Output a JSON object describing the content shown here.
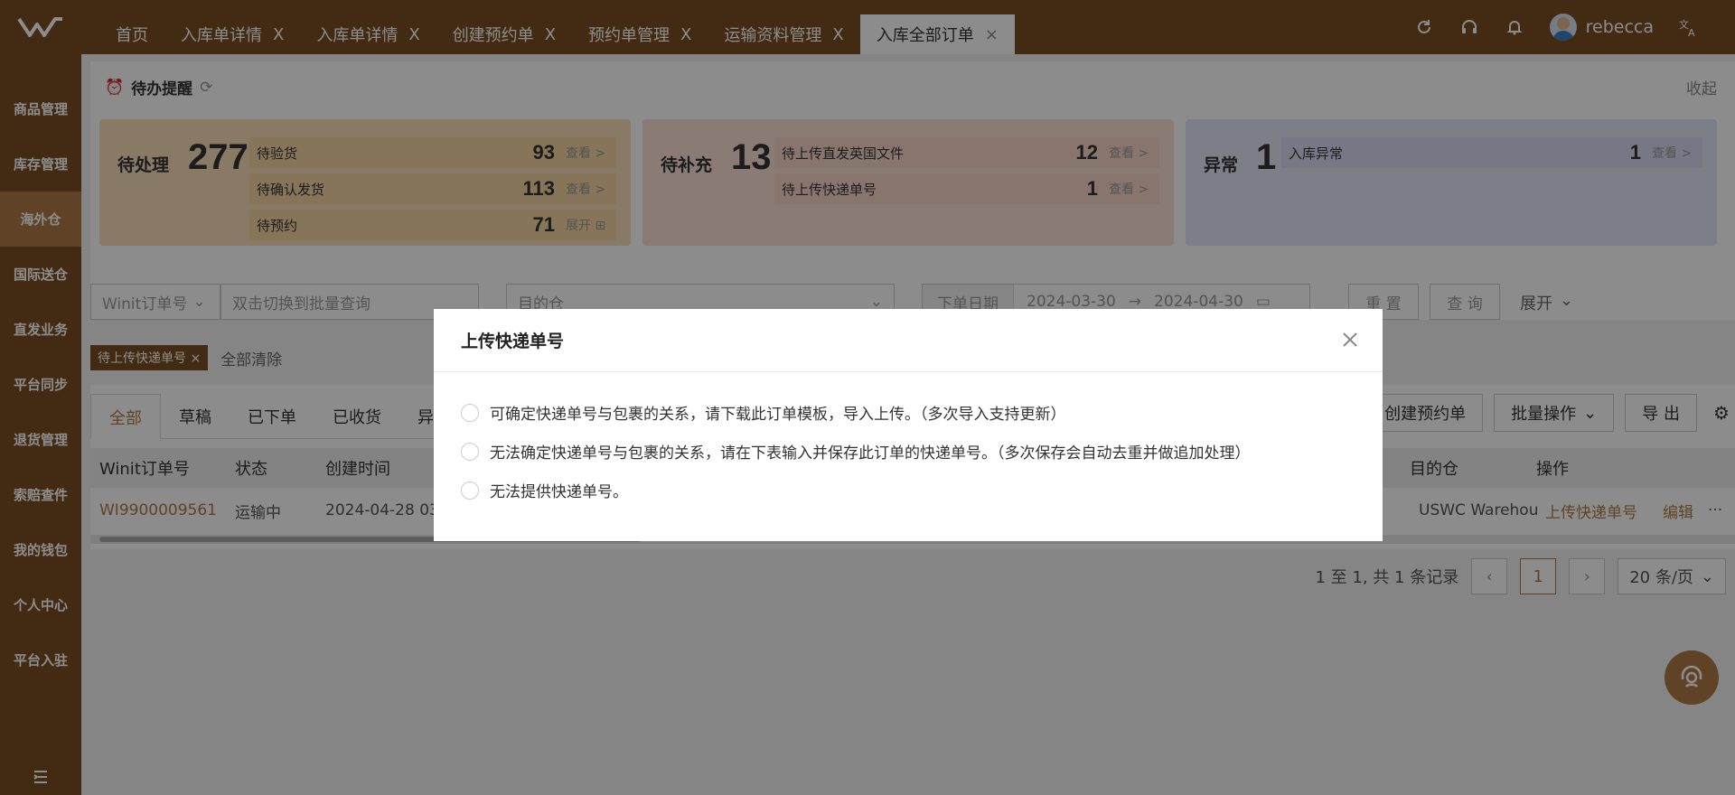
{
  "topbar": {
    "tabs": [
      {
        "label": "首页",
        "closable": false
      },
      {
        "label": "入库单详情",
        "closable": true
      },
      {
        "label": "入库单详情",
        "closable": true
      },
      {
        "label": "创建预约单",
        "closable": true
      },
      {
        "label": "预约单管理",
        "closable": true
      },
      {
        "label": "运输资料管理",
        "closable": true
      },
      {
        "label": "入库全部订单",
        "closable": true,
        "active": true
      }
    ],
    "close_glyph": "X",
    "username": "rebecca",
    "icons": [
      "refresh-icon",
      "headset-icon",
      "bell-icon",
      "translate-icon"
    ]
  },
  "sidebar": {
    "items": [
      {
        "label": "商品管理"
      },
      {
        "label": "库存管理"
      },
      {
        "label": "海外仓",
        "active": true
      },
      {
        "label": "国际送仓"
      },
      {
        "label": "直发业务"
      },
      {
        "label": "平台同步"
      },
      {
        "label": "退货管理"
      },
      {
        "label": "索赔查件"
      },
      {
        "label": "我的钱包"
      },
      {
        "label": "个人中心"
      },
      {
        "label": "平台入驻"
      }
    ]
  },
  "todo": {
    "title": "待办提醒",
    "collapse": "收起",
    "cards": [
      {
        "title": "待处理",
        "count": "277",
        "rows": [
          {
            "label": "待验货",
            "value": "93",
            "link": "查看 >"
          },
          {
            "label": "待确认发货",
            "value": "113",
            "link": "查看 >"
          },
          {
            "label": "待预约",
            "value": "71",
            "link": "展开 ⊞"
          }
        ]
      },
      {
        "title": "待补充",
        "count": "13",
        "rows": [
          {
            "label": "待上传直发英国文件",
            "value": "12",
            "link": "查看 >"
          },
          {
            "label": "待上传快递单号",
            "value": "1",
            "link": "查看 >"
          }
        ]
      },
      {
        "title": "异常",
        "count": "1",
        "rows": [
          {
            "label": "入库异常",
            "value": "1",
            "link": "查看 >"
          }
        ]
      }
    ]
  },
  "filters": {
    "order_type": "Winit订单号",
    "search_placeholder": "双击切换到批量查询",
    "warehouse_placeholder": "目的仓",
    "date_label": "下单日期",
    "date_start": "2024-03-30",
    "date_arrow": "→",
    "date_end": "2024-04-30",
    "reset": "重 置",
    "query": "查 询",
    "expand": "展开"
  },
  "active_tag": "待上传快递单号",
  "clear_all": "全部清除",
  "subtabs": [
    "全部",
    "草稿",
    "已下单",
    "已收货",
    "异"
  ],
  "actions": {
    "create": "创建预约单",
    "batch": "批量操作",
    "export": "导 出"
  },
  "table": {
    "headers": [
      "Winit订单号",
      "状态",
      "创建时间",
      "目的仓",
      "操作"
    ],
    "rows": [
      {
        "order": "WI9900009561",
        "status": "运输中",
        "created": "2024-04-28 03:",
        "warehouse": "USWC Warehou",
        "op1": "上传快递单号",
        "op2": "编辑",
        "more": "···"
      }
    ]
  },
  "pager": {
    "summary": "1 至 1, 共 1 条记录",
    "current": "1",
    "size": "20 条/页"
  },
  "modal": {
    "title": "上传快递单号",
    "options": [
      "可确定快递单号与包裹的关系，请下载此订单模板，导入上传。（多次导入支持更新）",
      "无法确定快递单号与包裹的关系，请在下表输入并保存此订单的快递单号。（多次保存会自动去重并做追加处理）",
      "无法提供快递单号。"
    ]
  },
  "colors": {
    "brand": "#7a4f24",
    "accent": "#b07a45"
  }
}
